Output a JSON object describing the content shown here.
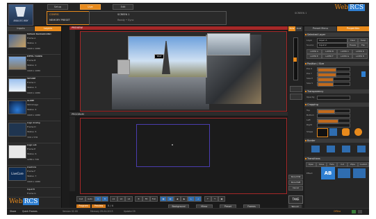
{
  "header": {
    "logo_text": "ANALOG WAY",
    "modes": [
      "Setup",
      "Live",
      "Edit"
    ],
    "active_mode": 1,
    "status_left_1": "CONFIG",
    "status_left_2": "MEMORY PRESET",
    "status_mid_1": "SCREEN 1",
    "status_mid_2": "Ready • Sync",
    "status_right": "SCREEN 1",
    "brand_prefix": "Web",
    "brand_box": "RCS"
  },
  "left_tabs": {
    "inputs": "Inputs",
    "layers": "Layers"
  },
  "left_items": [
    {
      "name": "MOSAIC BACKGROUND",
      "line2": "Frame A",
      "line3": "Status: 1",
      "line4": "1920 x 1080"
    },
    {
      "name": "EIFFEL TOWER",
      "line2": "Frame B",
      "line3": "Status: 2",
      "line4": "1920 x 1080"
    },
    {
      "name": "SKYLINE",
      "line2": "Frame C",
      "line3": "Status: 3",
      "line4": "1920 x 1080"
    },
    {
      "name": "GLOBE",
      "line2": "Still Image",
      "line3": "Status: 4",
      "line4": "1920 x 1080"
    },
    {
      "name": "Logo Analog",
      "line2": "Frame D",
      "line3": "Status: 5",
      "line4": "720 x 576"
    },
    {
      "name": "Logo sub",
      "line2": "Frame E",
      "line3": "Status: 6",
      "line4": "1280 x 720"
    },
    {
      "name": "LiveCore",
      "line2": "Frame F",
      "line3": "Status: 7",
      "line4": "1920 x 1080"
    },
    {
      "name": "Input 8",
      "line2": "Frame G",
      "line3": "Status: 8",
      "line4": "1920 x 1080"
    }
  ],
  "left_brand": {
    "prefix": "Web",
    "box": "RCS"
  },
  "preview": {
    "label": "PREVIEW",
    "overlay": "TEXT"
  },
  "program": {
    "label": "PROGRAM"
  },
  "toolbar": [
    "Cut",
    "Auto",
    "A",
    "B",
    "x1",
    "x2",
    "x4",
    "Fit",
    "Full"
  ],
  "center_bottom_buttons": [
    "Program",
    "Preview",
    "Background",
    "Mirror",
    "Preset",
    "Frames"
  ],
  "center_counter": "0 / 4",
  "sidebar": {
    "tabs": [
      "PVW",
      "PGM"
    ],
    "buttons": [
      "Store PVW",
      "Store PGM",
      "Cancel"
    ],
    "take": "TAKE",
    "take_label": "Take All"
  },
  "right_tabs": {
    "presets": "Preset Menu",
    "properties": "Properties"
  },
  "right_sections": {
    "selected_layer": "Selected Layer",
    "position_size": "Position / Size",
    "transparency": "Transparency",
    "cropping": "Cropping",
    "border": "Border",
    "transitions": "Transitions"
  },
  "selected_layer": {
    "layer_label": "Layer",
    "layer_value": "Layer A",
    "source_label": "Source",
    "source_value": "Input 2",
    "buttons": [
      "Clear",
      "Swap",
      "Freeze",
      "Flip"
    ],
    "grid_buttons": [
      "LAYER A",
      "LAYER B",
      "LAYER C",
      "LAYER D",
      "LAYER E",
      "LAYER F",
      "LAYER G",
      "LAYER H"
    ]
  },
  "position": {
    "rows": [
      "Pos X",
      "Pos Y",
      "Size H",
      "Size V"
    ],
    "fill": [
      0.55,
      0.55,
      0.45,
      0.45
    ]
  },
  "transparency": {
    "label": "Opacity",
    "fill": 0.0
  },
  "cropping": {
    "rows": [
      "Top",
      "Bottom",
      "Left",
      "Right"
    ],
    "fill": [
      0.5,
      0.0,
      0.6,
      0.0
    ],
    "shape_label": "Shape"
  },
  "transitions": {
    "tabs": [
      "Open",
      "Close",
      "Fade",
      "Cut",
      "Wipe",
      "Custom"
    ],
    "effect_label": "Effect",
    "btn": "AB"
  },
  "statusline": {
    "items": [
      "Share",
      "Quick Frames",
      "Version 02.00",
      "Memory 09-04-2013",
      "Update 09"
    ],
    "right": "Offline"
  }
}
